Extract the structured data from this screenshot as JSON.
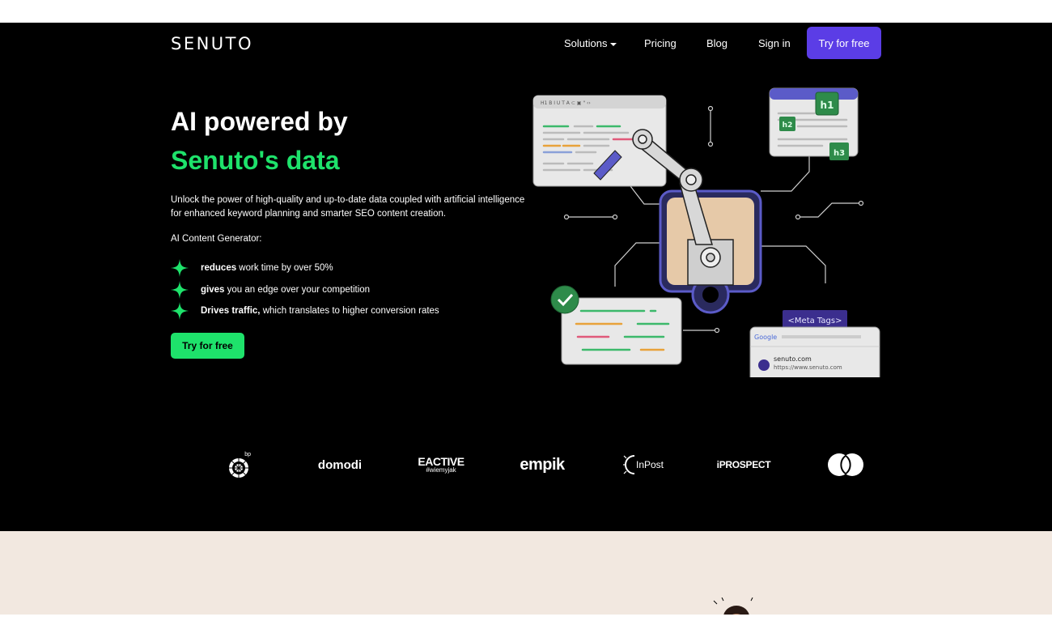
{
  "nav": {
    "logo": "SENUTO",
    "items": [
      {
        "label": "Solutions",
        "has_dropdown": true
      },
      {
        "label": "Pricing"
      },
      {
        "label": "Blog"
      },
      {
        "label": "Sign in"
      }
    ],
    "cta": "Try for free"
  },
  "hero": {
    "title_line1": "AI powered by",
    "title_line2": "Senuto's data",
    "lead": "Unlock the power of high-quality and up-to-date data coupled with artificial intelligence for enhanced keyword planning and smarter SEO content creation.",
    "sublabel": "AI Content Generator:",
    "bullets": [
      {
        "bold": "reduces",
        "rest": " work time by over 50%"
      },
      {
        "bold": "gives",
        "rest": " you an edge over your competition"
      },
      {
        "bold": "Drives traffic,",
        "rest": " which translates to higher conversion rates"
      }
    ],
    "cta": "Try for free"
  },
  "illustration": {
    "meta_tags_label": "<Meta Tags>",
    "google_label": "Google",
    "serp_title": "senuto.com",
    "serp_url": "https://www.senuto.com",
    "h1": "h1",
    "h2": "h2",
    "h3": "h3"
  },
  "brands": {
    "bp": "bp",
    "domodi": "domodi",
    "eactive": "EACTIVE",
    "eactive_tag": "#wiemyjak",
    "empik": "empik",
    "inpost": "InPost",
    "iprospect": "iPROSPECT",
    "mastercard": "mastercard"
  },
  "colors": {
    "accent_green": "#1ee26b",
    "accent_purple": "#5b3de6",
    "background": "#000000",
    "band": "#f2e8e0"
  }
}
